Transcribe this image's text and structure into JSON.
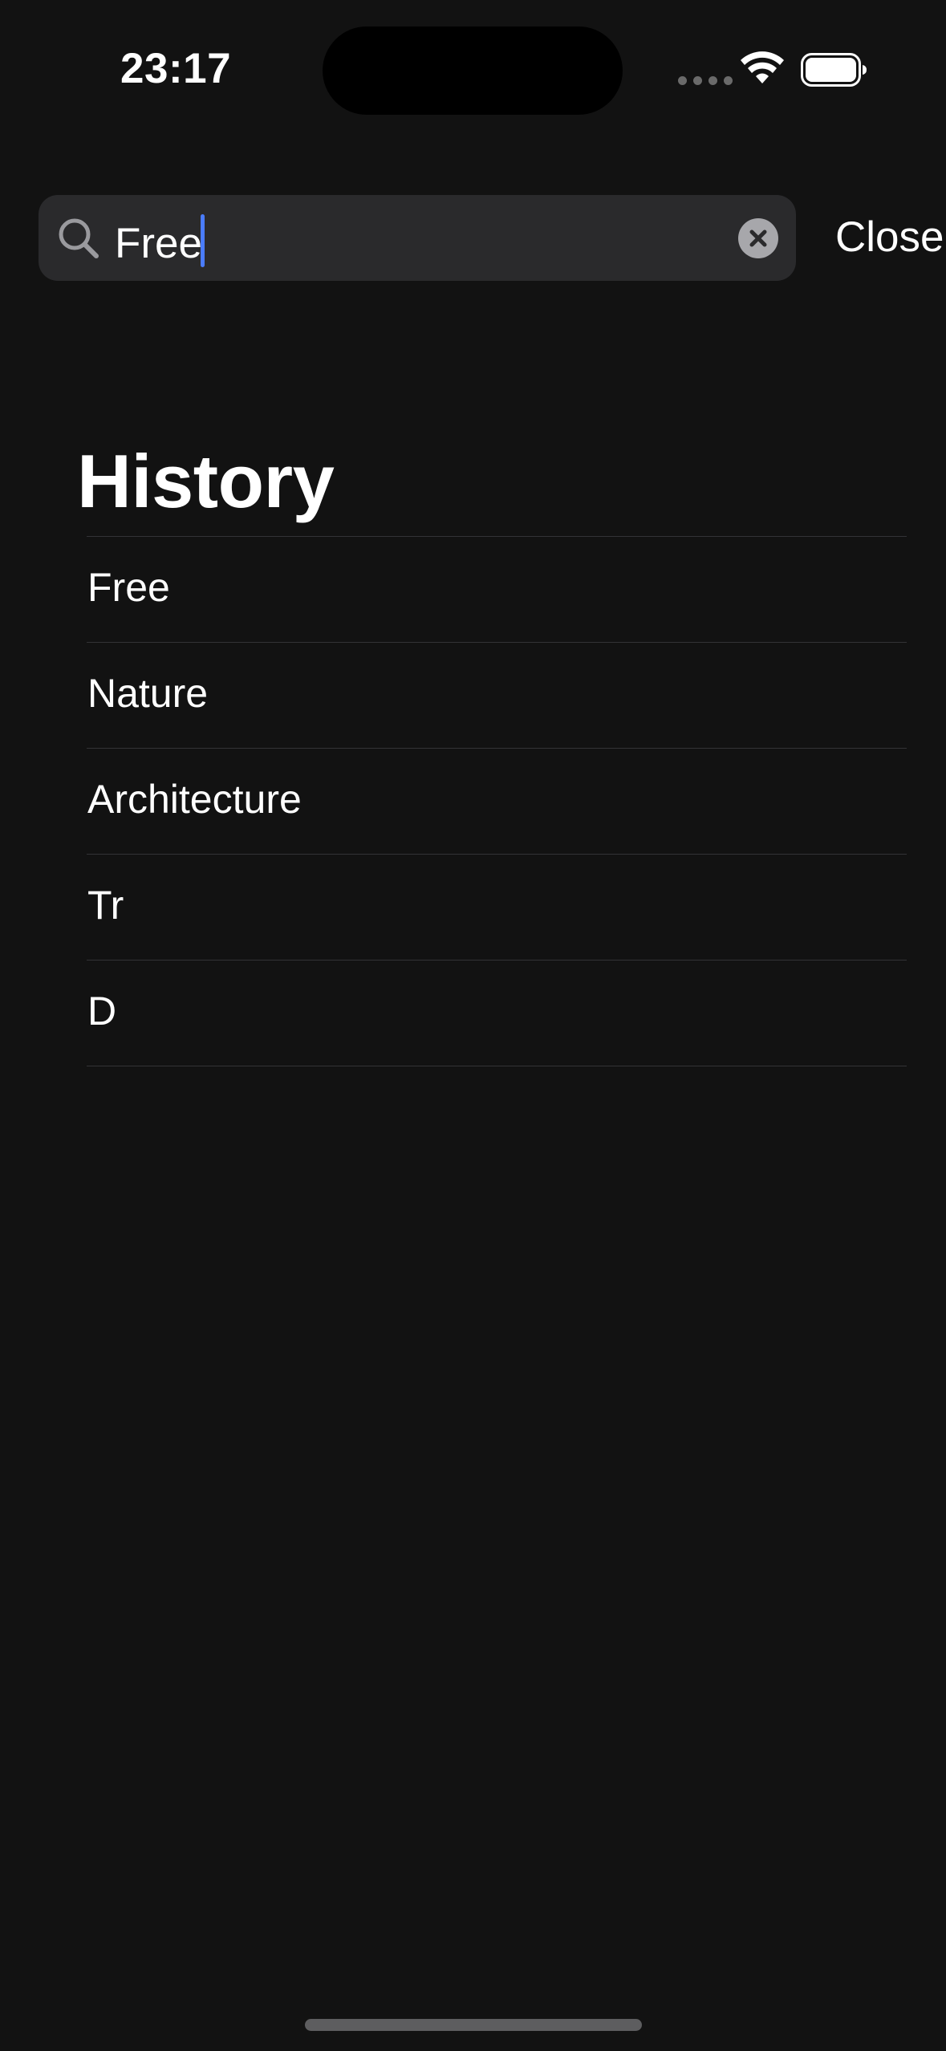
{
  "status_bar": {
    "time": "23:17",
    "icons": [
      "signal-dots-icon",
      "wifi-icon",
      "battery-icon"
    ]
  },
  "search": {
    "value": "Free",
    "icon": "search-icon",
    "clear_icon": "clear-icon",
    "close_label": "Close"
  },
  "history": {
    "title": "History",
    "items": [
      "Free",
      "Nature",
      "Architecture",
      "Tr",
      "D"
    ]
  },
  "colors": {
    "background": "#121212",
    "search_field": "#2a2a2c",
    "caret": "#4a7cff",
    "separator": "#333336"
  }
}
